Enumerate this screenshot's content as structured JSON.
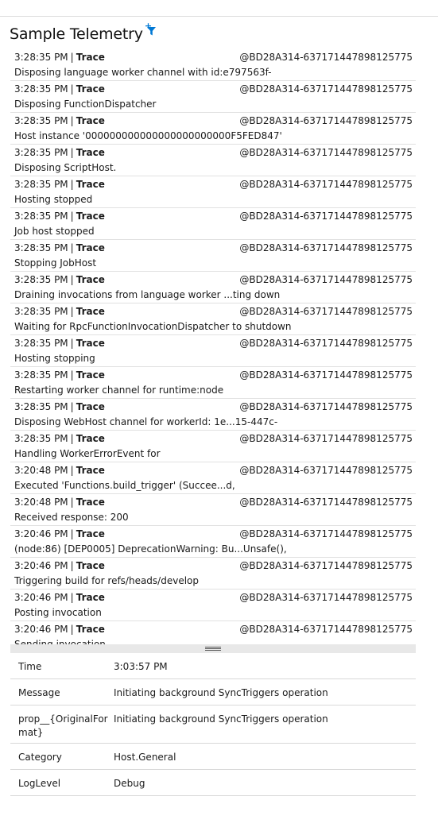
{
  "header": {
    "title": "Sample Telemetry",
    "filter_plus": "+"
  },
  "entries": [
    {
      "time": "3:28:35 PM",
      "level": "Trace",
      "source": "@BD28A314-637171447898125775",
      "message": "Disposing language worker channel with id:e797563f-"
    },
    {
      "time": "3:28:35 PM",
      "level": "Trace",
      "source": "@BD28A314-637171447898125775",
      "message": "Disposing FunctionDispatcher"
    },
    {
      "time": "3:28:35 PM",
      "level": "Trace",
      "source": "@BD28A314-637171447898125775",
      "message": "Host instance '000000000000000000000000F5FED847'"
    },
    {
      "time": "3:28:35 PM",
      "level": "Trace",
      "source": "@BD28A314-637171447898125775",
      "message": "Disposing ScriptHost."
    },
    {
      "time": "3:28:35 PM",
      "level": "Trace",
      "source": "@BD28A314-637171447898125775",
      "message": "Hosting stopped"
    },
    {
      "time": "3:28:35 PM",
      "level": "Trace",
      "source": "@BD28A314-637171447898125775",
      "message": "Job host stopped"
    },
    {
      "time": "3:28:35 PM",
      "level": "Trace",
      "source": "@BD28A314-637171447898125775",
      "message": "Stopping JobHost"
    },
    {
      "time": "3:28:35 PM",
      "level": "Trace",
      "source": "@BD28A314-637171447898125775",
      "message": "Draining invocations from language worker ...ting down"
    },
    {
      "time": "3:28:35 PM",
      "level": "Trace",
      "source": "@BD28A314-637171447898125775",
      "message": "Waiting for RpcFunctionInvocationDispatcher to shutdown"
    },
    {
      "time": "3:28:35 PM",
      "level": "Trace",
      "source": "@BD28A314-637171447898125775",
      "message": "Hosting stopping"
    },
    {
      "time": "3:28:35 PM",
      "level": "Trace",
      "source": "@BD28A314-637171447898125775",
      "message": "Restarting worker channel for runtime:node"
    },
    {
      "time": "3:28:35 PM",
      "level": "Trace",
      "source": "@BD28A314-637171447898125775",
      "message": "Disposing WebHost channel for workerId: 1e...15-447c-"
    },
    {
      "time": "3:28:35 PM",
      "level": "Trace",
      "source": "@BD28A314-637171447898125775",
      "message": "Handling WorkerErrorEvent for"
    },
    {
      "time": "3:20:48 PM",
      "level": "Trace",
      "source": "@BD28A314-637171447898125775",
      "message": "Executed 'Functions.build_trigger' (Succee...d,"
    },
    {
      "time": "3:20:48 PM",
      "level": "Trace",
      "source": "@BD28A314-637171447898125775",
      "message": "Received response: 200"
    },
    {
      "time": "3:20:46 PM",
      "level": "Trace",
      "source": "@BD28A314-637171447898125775",
      "message": "(node:86) [DEP0005] DeprecationWarning: Bu...Unsafe(),"
    },
    {
      "time": "3:20:46 PM",
      "level": "Trace",
      "source": "@BD28A314-637171447898125775",
      "message": "Triggering build for refs/heads/develop"
    },
    {
      "time": "3:20:46 PM",
      "level": "Trace",
      "source": "@BD28A314-637171447898125775",
      "message": "Posting invocation"
    },
    {
      "time": "3:20:46 PM",
      "level": "Trace",
      "source": "@BD28A314-637171447898125775",
      "message": "Sending invocation"
    }
  ],
  "details": {
    "time": {
      "key": "Time",
      "value": "3:03:57 PM"
    },
    "message": {
      "key": "Message",
      "value": "Initiating background SyncTriggers operation"
    },
    "original_format": {
      "key": "prop__{OriginalFor mat}",
      "value": "Initiating background SyncTriggers operation"
    },
    "category": {
      "key": "Category",
      "value": "Host.General"
    },
    "log_level": {
      "key": "LogLevel",
      "value": "Debug"
    }
  },
  "colors": {
    "accent": "#0078d4",
    "divider": "#e1e1e1",
    "splitter": "#e8e8e8"
  }
}
